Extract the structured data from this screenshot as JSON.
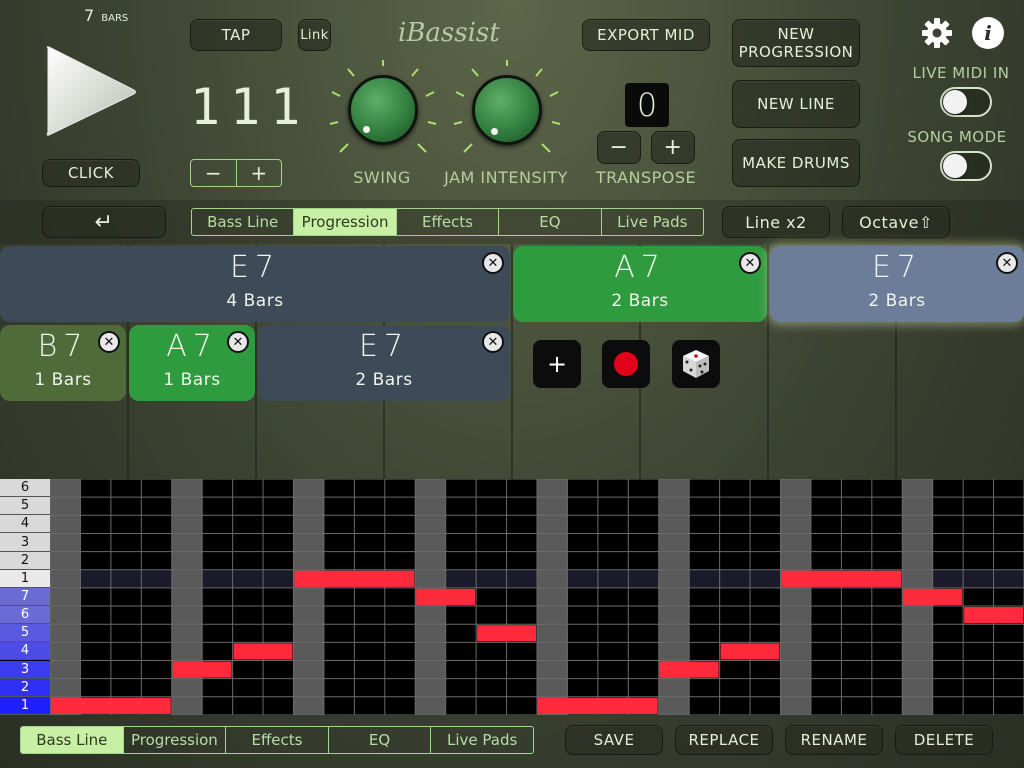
{
  "header": {
    "bars_count": "7",
    "bars_label": "BARS",
    "logo_text": "iBassist",
    "tap_label": "TAP",
    "link_label": "Link",
    "tempo_value": "111",
    "minus_label": "−",
    "plus_label": "+",
    "click_label": "CLICK",
    "export_label": "EXPORT MID",
    "new_progression_label": "NEW\nPROGRESSION",
    "new_line_label": "NEW LINE",
    "make_drums_label": "MAKE DRUMS",
    "transpose_value": "0",
    "transpose_label": "TRANSPOSE",
    "swing_label": "SWING",
    "jam_intensity_label": "JAM INTENSITY",
    "live_midi_label": "LIVE MIDI IN",
    "song_mode_label": "SONG MODE",
    "gear_icon": "gear-icon",
    "info_icon": "info-icon"
  },
  "top_tabs": {
    "return_icon": "↵",
    "items": [
      "Bass Line",
      "Progression",
      "Effects",
      "EQ",
      "Live Pads"
    ],
    "active": 1,
    "line_x2_label": "Line x2",
    "octave_label": "Octave⇧"
  },
  "chords": [
    {
      "name": "E7",
      "bars": "4 Bars",
      "color": "#3d4a58"
    },
    {
      "name": "A7",
      "bars": "2 Bars",
      "color": "#2f9b3f"
    },
    {
      "name": "E7",
      "bars": "2 Bars",
      "color": "#6b7d98"
    },
    {
      "name": "B7",
      "bars": "1 Bars",
      "color": "#4f6b3a"
    },
    {
      "name": "A7",
      "bars": "1 Bars",
      "color": "#2f9b3f"
    },
    {
      "name": "E7",
      "bars": "2 Bars",
      "color": "#3d4a58"
    }
  ],
  "chord_actions": {
    "add_label": "+",
    "record_icon": "record-icon",
    "dice_icon": "dice-icon"
  },
  "note_grid": {
    "row_labels": [
      "6",
      "5",
      "4",
      "3",
      "2",
      "1",
      "7",
      "6",
      "5",
      "4",
      "3",
      "2",
      "1"
    ],
    "note_color": "#ff2a3c"
  },
  "bottom_tabs": {
    "items": [
      "Bass Line",
      "Progression",
      "Effects",
      "EQ",
      "Live Pads"
    ],
    "active": 0
  },
  "bottom_actions": {
    "save_label": "SAVE",
    "replace_label": "REPLACE",
    "rename_label": "RENAME",
    "delete_label": "DELETE"
  }
}
